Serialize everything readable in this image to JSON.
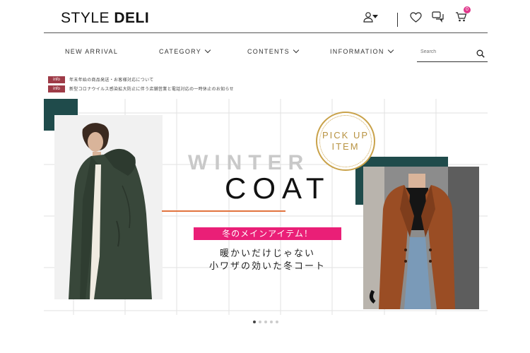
{
  "header": {
    "logo_light": "STYLE ",
    "logo_bold": "DELI",
    "icons": [
      "user-icon",
      "chevron-down-icon",
      "heart-icon",
      "chat-icon",
      "cart-icon"
    ],
    "cart_count": "0"
  },
  "nav": {
    "items": [
      {
        "label": "NEW ARRIVAL",
        "dropdown": false
      },
      {
        "label": "CATEGORY",
        "dropdown": true
      },
      {
        "label": "CONTENTS",
        "dropdown": true
      },
      {
        "label": "INFORMATION",
        "dropdown": true
      }
    ],
    "search_placeholder": "Search"
  },
  "info": [
    {
      "tag": "info",
      "text": "年末年始の商品発送・お客様対応について"
    },
    {
      "tag": "info",
      "text": "新型コロナウイルス感染拡大防止に伴う店舗営業と電話対応の一時休止のお知らせ"
    }
  ],
  "banner": {
    "winter": "WINTER",
    "coat": "COAT",
    "pickup_line1": "PICK UP",
    "pickup_line2": "ITEM",
    "pink_label": "冬のメインアイテム！",
    "line1": "暖かいだけじゃない",
    "line2": "小ワザの効いた冬コート"
  },
  "colors": {
    "accent_pink": "#ea1f77",
    "deep_green": "#1f4b4b",
    "gold": "#c9a24a",
    "orange": "#e2733e",
    "info_tag": "#9e3b47"
  },
  "carousel": {
    "count": 5,
    "active": 1
  }
}
